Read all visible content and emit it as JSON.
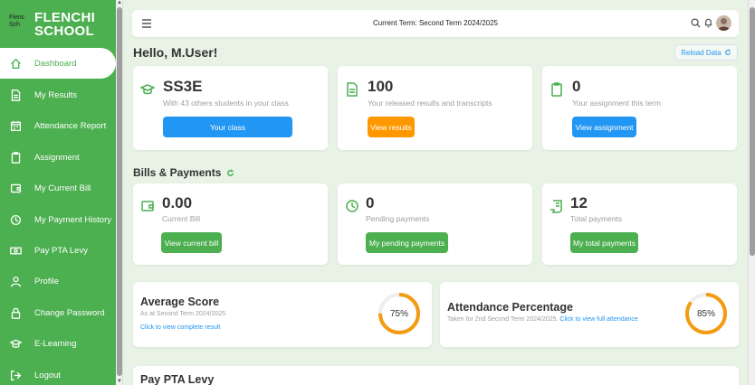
{
  "sidebar": {
    "logo_alt": "Flenc Sch",
    "brand_line1": "FLENCHI",
    "brand_line2": "SCHOOL",
    "items": [
      {
        "label": "Dashboard"
      },
      {
        "label": "My Results"
      },
      {
        "label": "Attendance Report"
      },
      {
        "label": "Assignment"
      },
      {
        "label": "My Current Bill"
      },
      {
        "label": "My Payment History"
      },
      {
        "label": "Pay PTA Levy"
      },
      {
        "label": "Profile"
      },
      {
        "label": "Change Password"
      },
      {
        "label": "E-Learning"
      },
      {
        "label": "Logout"
      }
    ]
  },
  "topbar": {
    "term": "Current Term: Second Term 2024/2025"
  },
  "greeting": "Hello, M.User!",
  "reload_label": "Reload Data",
  "summary": [
    {
      "big": "SS3E",
      "sub": "With 43 others students in your class",
      "button": "Your class",
      "color": "#2196f3"
    },
    {
      "big": "100",
      "sub": "Your released results and transcripts",
      "button": "View results",
      "color": "#ff9800"
    },
    {
      "big": "0",
      "sub": "Your assignment this term",
      "button": "View assignment",
      "color": "#2196f3"
    }
  ],
  "bills": {
    "title": "Bills & Payments",
    "cards": [
      {
        "big": "0.00",
        "sub": "Current Bill",
        "button": "View current bill"
      },
      {
        "big": "0",
        "sub": "Pending payments",
        "button": "My pending payments"
      },
      {
        "big": "12",
        "sub": "Total payments",
        "button": "My total payments"
      }
    ],
    "button_color": "#4caf50"
  },
  "average": {
    "title": "Average Score",
    "sub": "As at Second Term 2024/2025",
    "link": "Click to view complete result",
    "value_label": "75%",
    "value": 0.75
  },
  "attendance": {
    "title": "Attendance Percentage",
    "sub": "Taken for 2nd Second Term 2024/2025.",
    "link": "Click to view full attendance",
    "value_label": "85%",
    "value": 0.85
  },
  "pta": {
    "title": "Pay PTA Levy"
  },
  "colors": {
    "brand": "#4caf50",
    "ring": "#f39c12",
    "link": "#2196f3"
  }
}
